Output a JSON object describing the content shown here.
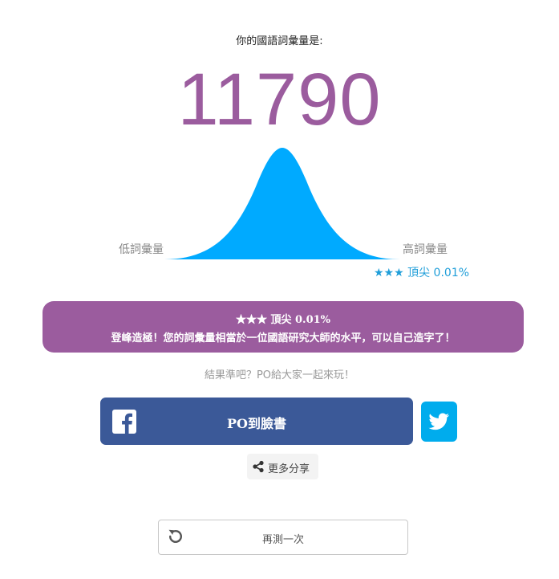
{
  "heading": "你的國語詞彙量是:",
  "score": "11790",
  "distribution": {
    "low_label": "低詞彙量",
    "high_label": "高詞彙量",
    "curve_color": "#00aaff"
  },
  "rank_small": "★★★ 頂尖 0.01%",
  "result": {
    "rank": "★★★ 頂尖 0.01%",
    "description": "登峰造極！您的詞彙量相當於一位國語研究大師的水平，可以自己造字了！",
    "bg_color": "#9b5c9e"
  },
  "share_prompt": "結果準吧？PO給大家一起來玩！",
  "facebook": {
    "label": "PO到臉書",
    "icon": "facebook-icon",
    "color": "#3b5998"
  },
  "twitter": {
    "icon": "twitter-icon",
    "color": "#00aced"
  },
  "more_share": {
    "label": "更多分享",
    "icon": "share-icon"
  },
  "retry": {
    "label": "再測一次",
    "icon": "refresh-icon"
  }
}
